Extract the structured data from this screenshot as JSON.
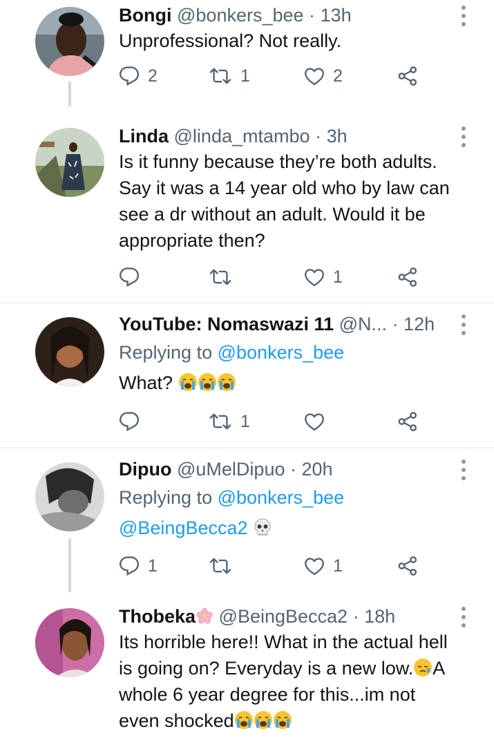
{
  "tweets": [
    {
      "name": "Bongi",
      "handle": "@bonkers_bee",
      "dot": "·",
      "time": "13h",
      "text": "Unprofessional? Not really.",
      "reply_count": "2",
      "retweet_count": "1",
      "like_count": "2"
    },
    {
      "name": "Linda",
      "handle": "@linda_mtambo",
      "dot": "·",
      "time": "3h",
      "lines": [
        "Is it funny because they’re both adults.",
        "Say it was a 14 year old who by law can",
        "see a dr without an adult. Would it be",
        "appropriate then?"
      ],
      "reply_count": "",
      "retweet_count": "",
      "like_count": "1"
    },
    {
      "name": "YouTube: Nomaswazi 11",
      "handle": "@N...",
      "dot": "·",
      "time": "12h",
      "replying_prefix": "Replying to",
      "replying_mention": "@bonkers_bee",
      "text": "What?",
      "emoji": [
        "loudly-crying-face",
        "loudly-crying-face",
        "loudly-crying-face"
      ],
      "reply_count": "",
      "retweet_count": "1",
      "like_count": ""
    },
    {
      "name": "Dipuo",
      "handle": "@uMelDipuo",
      "dot": "·",
      "time": "20h",
      "replying_prefix": "Replying to",
      "replying_mention": "@bonkers_bee",
      "mention": "@BeingBecca2",
      "emoji": [
        "skull"
      ],
      "reply_count": "1",
      "retweet_count": "",
      "like_count": "1"
    },
    {
      "name": "Thobeka",
      "name_emoji": "cherry-blossom",
      "handle": "@BeingBecca2",
      "dot": "·",
      "time": "18h",
      "lines": [
        "Its horrible here!! What in the actual hell",
        "is going on? Everyday is a new low.",
        "A",
        "whole 6 year degree for this...im not",
        "even shocked"
      ],
      "emoji_after_line2": "sleepy-face",
      "emoji_after_line5": [
        "loudly-crying-face",
        "loudly-crying-face",
        "loudly-crying-face"
      ]
    }
  ],
  "colors": {
    "text": "#0f1419",
    "muted": "#536471",
    "link": "#1d9bf0",
    "divider": "#eff3f4",
    "thread": "#cfd9de"
  },
  "icons": [
    "reply-icon",
    "retweet-icon",
    "like-icon",
    "share-icon",
    "more-icon"
  ]
}
